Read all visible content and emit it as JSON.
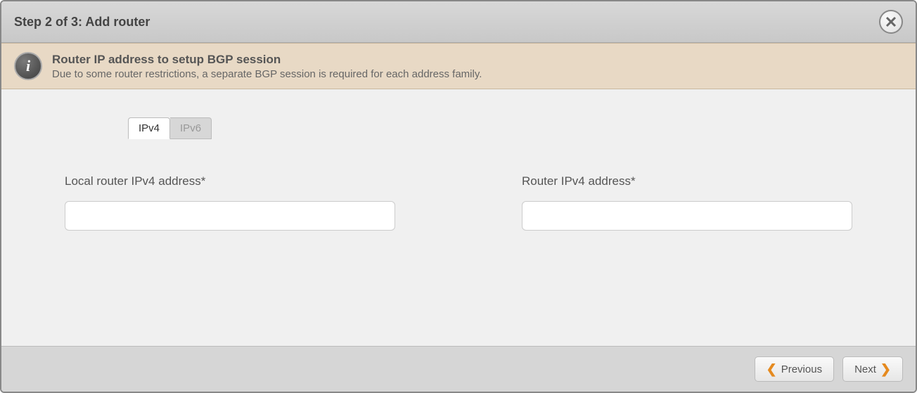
{
  "header": {
    "title": "Step 2 of 3: Add router"
  },
  "info": {
    "title": "Router IP address to setup BGP session",
    "description": "Due to some router restrictions, a separate BGP session is required for each address family."
  },
  "tabs": {
    "ipv4": "IPv4",
    "ipv6": "IPv6"
  },
  "fields": {
    "local_label": "Local router IPv4 address*",
    "local_value": "",
    "router_label": "Router IPv4 address*",
    "router_value": ""
  },
  "footer": {
    "previous": "Previous",
    "next": "Next"
  }
}
